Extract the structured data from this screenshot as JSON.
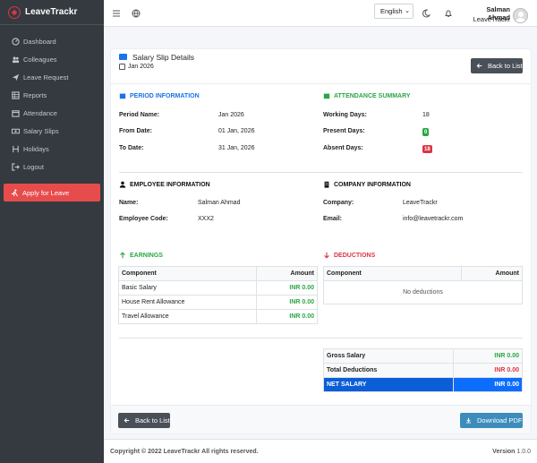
{
  "brand": {
    "name": "LeaveTrackr"
  },
  "sidebar": {
    "items": [
      {
        "label": "Dashboard",
        "icon": "dashboard-icon"
      },
      {
        "label": "Colleagues",
        "icon": "users-icon"
      },
      {
        "label": "Leave Request",
        "icon": "plane-icon"
      },
      {
        "label": "Reports",
        "icon": "table-icon"
      },
      {
        "label": "Attendance",
        "icon": "calendar-icon"
      },
      {
        "label": "Salary Slips",
        "icon": "money-icon"
      },
      {
        "label": "Holidays",
        "icon": "holiday-icon"
      },
      {
        "label": "Logout",
        "icon": "logout-icon"
      }
    ],
    "apply_button": "Apply for Leave"
  },
  "topbar": {
    "language": "English",
    "user_name": "Salman Ahmad",
    "user_company": "LeaveTrackr"
  },
  "header": {
    "title": "Salary Slip Details",
    "period": "Jan 2026",
    "back_button": "Back to List"
  },
  "period_info": {
    "title": "PERIOD INFORMATION",
    "rows": [
      {
        "label": "Period Name:",
        "value": "Jan 2026"
      },
      {
        "label": "From Date:",
        "value": "01 Jan, 2026"
      },
      {
        "label": "To Date:",
        "value": "31 Jan, 2026"
      }
    ]
  },
  "attendance": {
    "title": "ATTENDANCE SUMMARY",
    "working_label": "Working Days:",
    "working_value": "18",
    "present_label": "Present Days:",
    "present_value": "0",
    "absent_label": "Absent Days:",
    "absent_value": "18"
  },
  "employee": {
    "title": "EMPLOYEE INFORMATION",
    "name_label": "Name:",
    "name_value": "Salman Ahmad",
    "code_label": "Employee Code:",
    "code_value": "XXX2"
  },
  "company": {
    "title": "COMPANY INFORMATION",
    "company_label": "Company:",
    "company_value": "LeaveTrackr",
    "email_label": "Email:",
    "email_value": "info@leavetrackr.com"
  },
  "earnings": {
    "title": "EARNINGS",
    "col_component": "Component",
    "col_amount": "Amount",
    "rows": [
      {
        "component": "Basic Salary",
        "amount": "INR 0.00"
      },
      {
        "component": "House Rent Allowance",
        "amount": "INR 0.00"
      },
      {
        "component": "Travel Allowance",
        "amount": "INR 0.00"
      }
    ]
  },
  "deductions": {
    "title": "DEDUCTIONS",
    "col_component": "Component",
    "col_amount": "Amount",
    "empty": "No deductions"
  },
  "summary": {
    "gross_label": "Gross Salary",
    "gross_value": "INR 0.00",
    "deductions_label": "Total Deductions",
    "deductions_value": "INR 0.00",
    "net_label": "NET SALARY",
    "net_value": "INR 0.00"
  },
  "footer_buttons": {
    "back": "Back to List",
    "download": "Download PDF"
  },
  "footer": {
    "copyright": "Copyright © 2022 LeaveTrackr All rights reserved.",
    "version_label": "Version",
    "version_value": "1.0.0"
  },
  "colors": {
    "sidebar_bg": "#343a40",
    "apply_button": "#e74c4c",
    "net_salary_bg": "#0d6efd",
    "earnings": "#28a745",
    "deductions": "#dc3545",
    "section_blue": "#1a73e8"
  }
}
